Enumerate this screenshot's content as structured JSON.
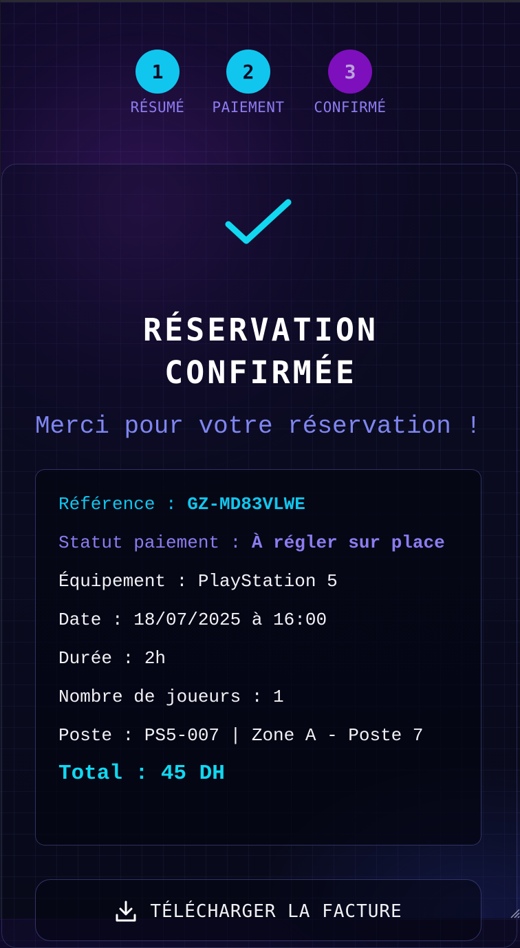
{
  "stepper": {
    "steps": [
      {
        "number": "1",
        "label": "RÉSUMÉ",
        "state": "done"
      },
      {
        "number": "2",
        "label": "PAIEMENT",
        "state": "done"
      },
      {
        "number": "3",
        "label": "CONFIRMÉ",
        "state": "active"
      }
    ]
  },
  "confirmation": {
    "icon": "checkmark-icon",
    "title_line1": "RÉSERVATION",
    "title_line2": "CONFIRMÉE",
    "subtitle": "Merci pour votre réservation !"
  },
  "details": {
    "reference_label": "Référence : ",
    "reference_value": "GZ-MD83VLWE",
    "payment_label": "Statut paiement : ",
    "payment_value": "À régler sur place",
    "equipment": "Équipement : PlayStation 5",
    "date": "Date : 18/07/2025 à 16:00",
    "duration": "Durée : 2h",
    "players": "Nombre de joueurs : 1",
    "station": "Poste : PS5-007 | Zone A - Poste 7",
    "total": "Total : 45 DH"
  },
  "actions": {
    "download_label": "TÉLÉCHARGER LA FACTURE",
    "download_icon": "download-icon"
  },
  "colors": {
    "accent_cyan": "#11c6ee",
    "accent_purple": "#7e0fbd",
    "label_violet": "#8d7cf0",
    "background": "#090a1a"
  }
}
